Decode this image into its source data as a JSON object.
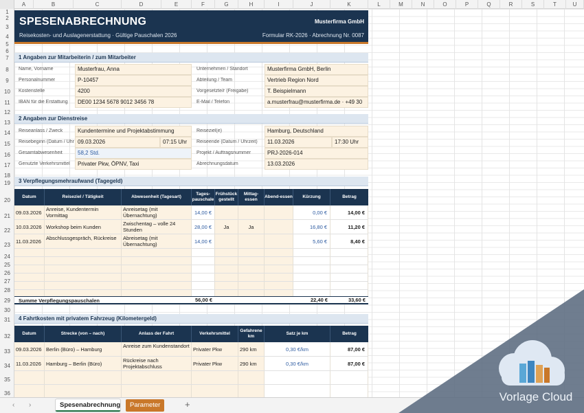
{
  "columns": [
    "A",
    "B",
    "C",
    "D",
    "E",
    "F",
    "G",
    "H",
    "I",
    "J",
    "K",
    "L",
    "M",
    "N",
    "O",
    "P",
    "Q",
    "R",
    "S",
    "T",
    "U"
  ],
  "rows": [
    "1",
    "2",
    "3",
    "4",
    "5",
    "6",
    "7",
    "8",
    "9",
    "10",
    "11",
    "12",
    "13",
    "14",
    "15",
    "16",
    "17",
    "18",
    "19",
    "20",
    "21",
    "22",
    "23",
    "24",
    "25",
    "26",
    "27",
    "28",
    "29",
    "30",
    "31",
    "32",
    "33",
    "34",
    "35",
    "36"
  ],
  "banner": {
    "title": "SPESENABRECHNUNG",
    "company": "Musterfirma GmbH",
    "subtitle": "Reisekosten- und Auslagenerstattung · Gültige Pauschalen 2026",
    "form_no": "Formular RK-2026 · Abrechnung Nr. 0087"
  },
  "section1": {
    "title": "1   Angaben zur Mitarbeiterin / zum Mitarbeiter",
    "name_label": "Name, Vorname",
    "name": "Musterfrau, Anna",
    "pnr_label": "Personalnummer",
    "pnr": "P-10457",
    "kst_label": "Kostenstelle",
    "kst": "4200",
    "iban_label": "IBAN für die Erstattung",
    "iban": "DE00 1234 5678 9012 3456 78",
    "firma_label": "Unternehmen / Standort",
    "firma": "Musterfirma GmbH, Berlin",
    "abt_label": "Abteilung / Team",
    "abt": "Vertrieb Region Nord",
    "vorg_label": "Vorgesetzte/r (Freigabe)",
    "vorg": "T. Beispielmann",
    "mail_label": "E-Mail / Telefon",
    "mail": "a.musterfrau@musterfirma.de · +49 30"
  },
  "section2": {
    "title": "2   Angaben zur Dienstreise",
    "anlass_label": "Reiseanlass / Zweck",
    "anlass": "Kundentermine und Projektabstimmung",
    "beginn_label": "Reisebeginn (Datum / Uhr",
    "beginn_datum": "09.03.2026",
    "beginn_uhr": "07:15 Uhr",
    "dauer_label": "Gesamtabwesenheit",
    "dauer": "58,2 Std.",
    "verkehr_label": "Genutzte Verkehrsmittel",
    "verkehr": "Privater Pkw, ÖPNV, Taxi",
    "ziel_label": "Reiseziel(e)",
    "ziel": "Hamburg, Deutschland",
    "ende_label": "Reiseende (Datum / Uhrzeit)",
    "ende_datum": "11.03.2026",
    "ende_uhr": "17:30 Uhr",
    "projekt_label": "Projekt / Auftragsnummer",
    "projekt": "PRJ-2026-014",
    "abrdatum_label": "Abrechnungsdatum",
    "abrdatum": "13.03.2026"
  },
  "section3": {
    "title": "3   Verpflegungsmehraufwand (Tagegeld)",
    "headers": [
      "Datum",
      "Reiseziel / Tätigkeit",
      "Abwesenheit (Tagesart)",
      "Tages-pauschale",
      "Frühstück gestellt",
      "Mittag-essen",
      "Abend-essen",
      "Kürzung",
      "Betrag"
    ],
    "rows": [
      {
        "datum": "09.03.2026",
        "ziel": "Anreise, Kundentermin Vormittag",
        "art": "Anreisetag (mit Übernachtung)",
        "pausch": "14,00 €",
        "fr": "",
        "mi": "",
        "ab": "",
        "kuerz": "0,00 €",
        "betrag": "14,00 €"
      },
      {
        "datum": "10.03.2026",
        "ziel": "Workshop beim Kunden",
        "art": "Zwischentag – volle 24 Stunden",
        "pausch": "28,00 €",
        "fr": "Ja",
        "mi": "Ja",
        "ab": "",
        "kuerz": "16,80 €",
        "betrag": "11,20 €"
      },
      {
        "datum": "11.03.2026",
        "ziel": "Abschlussgespräch, Rückreise",
        "art": "Abreisetag (mit Übernachtung)",
        "pausch": "14,00 €",
        "fr": "",
        "mi": "",
        "ab": "",
        "kuerz": "5,60 €",
        "betrag": "8,40 €"
      }
    ],
    "sum_label": "Summe Verpflegungspauschalen",
    "sum_pausch": "56,00 €",
    "sum_kuerz": "22,40 €",
    "sum_betrag": "33,60 €"
  },
  "section4": {
    "title": "4   Fahrtkosten mit privatem Fahrzeug (Kilometergeld)",
    "headers": [
      "Datum",
      "Strecke (von – nach)",
      "Anlass der Fahrt",
      "Verkehrsmittel",
      "Gefahrene km",
      "Satz je km",
      "Betrag"
    ],
    "rows": [
      {
        "datum": "09.03.2026",
        "strecke": "Berlin (Büro) – Hamburg",
        "anlass": "Anreise zum Kundenstandort",
        "vm": "Privater Pkw",
        "km": "290 km",
        "satz": "0,30 €/km",
        "betrag": "87,00 €"
      },
      {
        "datum": "11.03.2026",
        "strecke": "Hamburg – Berlin (Büro)",
        "anlass": "Rückreise nach Projektabschluss",
        "vm": "Privater Pkw",
        "km": "290 km",
        "satz": "0,30 €/km",
        "betrag": "87,00 €"
      }
    ]
  },
  "tabs": {
    "active": "Spesenabrechnung",
    "param": "Parameter",
    "add": "+",
    "prev": "‹",
    "next": "›"
  },
  "watermark": {
    "text": "Vorlage Cloud"
  },
  "colors": {
    "navy": "#1b3450",
    "accent": "#c9782a",
    "input": "#fcf2e2",
    "section": "#dde6f0"
  }
}
